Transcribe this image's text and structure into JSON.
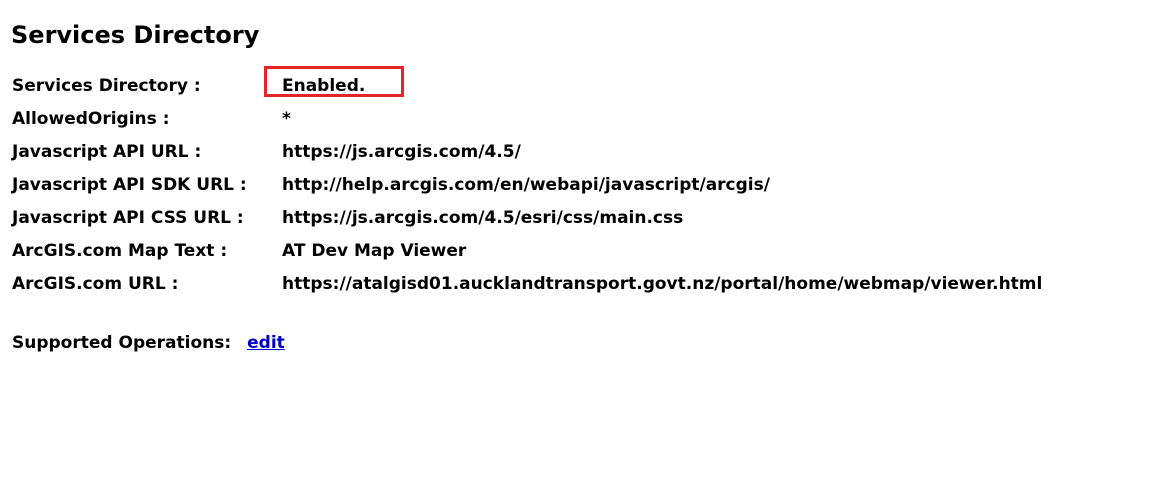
{
  "header": {
    "title": "Services Directory"
  },
  "properties": [
    {
      "label": "Services Directory :",
      "value": "Enabled."
    },
    {
      "label": "AllowedOrigins :",
      "value": "*"
    },
    {
      "label": "Javascript API URL :",
      "value": "https://js.arcgis.com/4.5/"
    },
    {
      "label": "Javascript API SDK URL :",
      "value": "http://help.arcgis.com/en/webapi/javascript/arcgis/"
    },
    {
      "label": "Javascript API CSS URL :",
      "value": "https://js.arcgis.com/4.5/esri/css/main.css"
    },
    {
      "label": "ArcGIS.com Map Text :",
      "value": "AT Dev Map Viewer"
    },
    {
      "label": "ArcGIS.com URL :",
      "value": "https://atalgisd01.aucklandtransport.govt.nz/portal/home/webmap/viewer.html"
    }
  ],
  "operations": {
    "label": "Supported Operations:",
    "links": [
      "edit"
    ]
  },
  "colors": {
    "highlight_border": "#e32528",
    "link": "#0000cc"
  }
}
